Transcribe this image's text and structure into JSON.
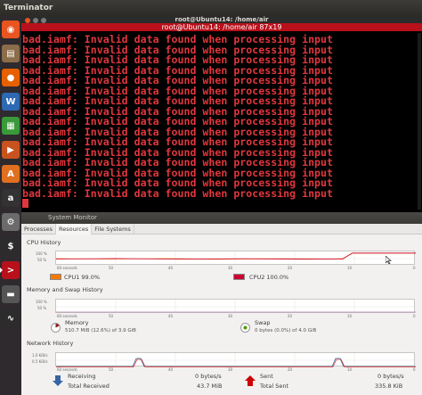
{
  "topbar": {
    "app_name": "Terminator"
  },
  "launcher": {
    "items": [
      {
        "icon": "ubuntu-dash-icon",
        "color": "#e95420"
      },
      {
        "icon": "files-icon",
        "color": "#8b6d4a"
      },
      {
        "icon": "firefox-icon",
        "color": "#e66000"
      },
      {
        "icon": "writer-icon",
        "color": "#2e69b3"
      },
      {
        "icon": "calc-icon",
        "color": "#3a9a3a"
      },
      {
        "icon": "impress-icon",
        "color": "#c9531e"
      },
      {
        "icon": "software-center-icon",
        "color": "#e07020"
      },
      {
        "icon": "amazon-icon",
        "color": "#333"
      },
      {
        "icon": "settings-icon",
        "color": "#6b6b6b"
      },
      {
        "icon": "terminal-icon",
        "color": "#2c2c2c"
      },
      {
        "icon": "terminator-icon",
        "color": "#b8111b"
      },
      {
        "icon": "usb-drive-icon",
        "color": "#555"
      },
      {
        "icon": "system-monitor-icon",
        "color": "#2c2c2c"
      }
    ]
  },
  "terminal": {
    "window_title": "root@Ubuntu14: /home/air",
    "tab_title": "root@Ubuntu14: /home/air 87x19",
    "lines": [
      "bad.iamf: Invalid data found when processing input",
      "bad.iamf: Invalid data found when processing input",
      "bad.iamf: Invalid data found when processing input",
      "bad.iamf: Invalid data found when processing input",
      "bad.iamf: Invalid data found when processing input",
      "bad.iamf: Invalid data found when processing input",
      "bad.iamf: Invalid data found when processing input",
      "bad.iamf: Invalid data found when processing input",
      "bad.iamf: Invalid data found when processing input",
      "bad.iamf: Invalid data found when processing input",
      "bad.iamf: Invalid data found when processing input",
      "bad.iamf: Invalid data found when processing input",
      "bad.iamf: Invalid data found when processing input",
      "bad.iamf: Invalid data found when processing input",
      "bad.iamf: Invalid data found when processing input",
      "bad.iamf: Invalid data found when processing input"
    ],
    "text_color": "#e0373d"
  },
  "sysmon": {
    "title": "System Monitor",
    "tabs": [
      "Processes",
      "Resources",
      "File Systems"
    ],
    "active_tab": 1,
    "cpu": {
      "section": "CPU History",
      "y_top": "100 %",
      "y_mid": "50 %",
      "x_labels": [
        "60 seconds",
        "50",
        "40",
        "30",
        "20",
        "10",
        "0"
      ],
      "cpu1_label": "CPU1 99.0%",
      "cpu1_color": "#f57900",
      "cpu2_label": "CPU2 100.0%",
      "cpu2_color": "#cc0033"
    },
    "memory": {
      "section": "Memory and Swap History",
      "y_top": "100 %",
      "y_mid": "50 %",
      "x_labels": [
        "60 seconds",
        "50",
        "40",
        "30",
        "20",
        "10",
        "0"
      ],
      "memory_label": "Memory",
      "memory_value": "510.7 MiB (12.6%) of 3.9 GiB",
      "swap_label": "Swap",
      "swap_value": "0 bytes (0.0%) of 4.0 GiB"
    },
    "network": {
      "section": "Network History",
      "y_top": "1.0 KiB/s",
      "y_mid": "0.5 KiB/s",
      "x_labels": [
        "60 seconds",
        "50",
        "40",
        "30",
        "20",
        "10",
        "0"
      ],
      "receiving_label": "Receiving",
      "receiving_value": "0 bytes/s",
      "total_received_label": "Total Received",
      "total_received_value": "43.7 MiB",
      "sent_label": "Sent",
      "sent_value": "0 bytes/s",
      "total_sent_label": "Total Sent",
      "total_sent_value": "335.8 KiB"
    }
  }
}
